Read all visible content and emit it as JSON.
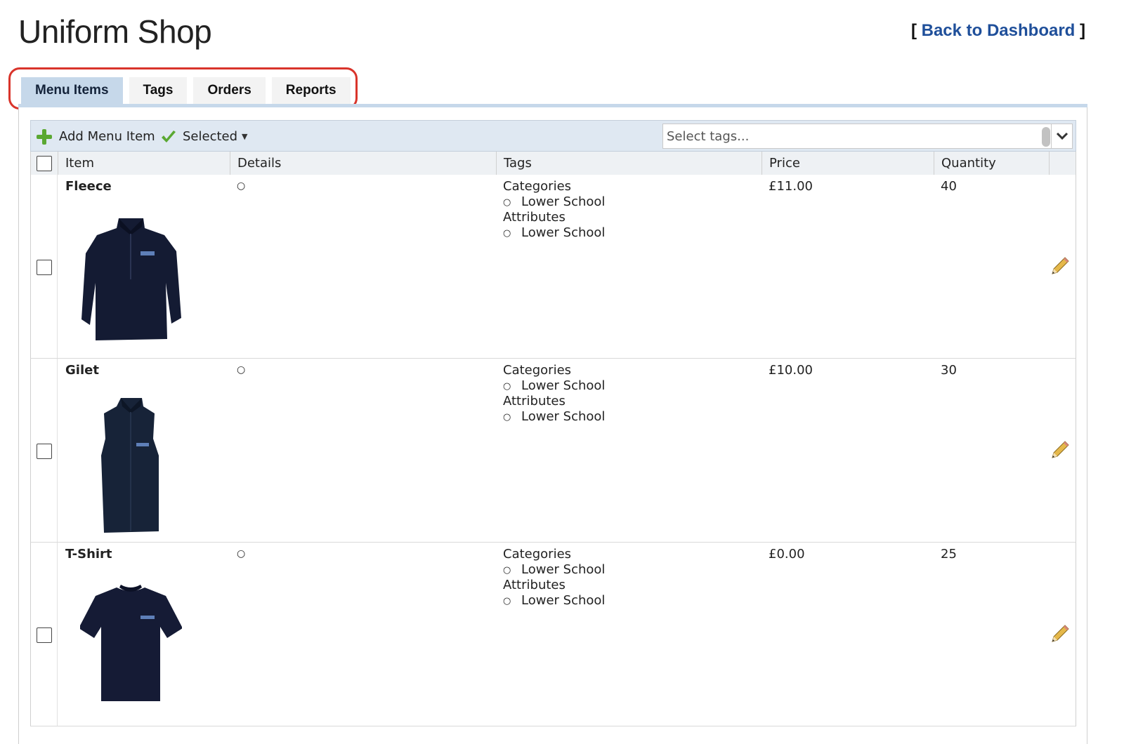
{
  "header": {
    "title": "Uniform Shop",
    "back_link": "Back to Dashboard",
    "back_open": "[",
    "back_close": "]"
  },
  "tabs": [
    {
      "label": "Menu Items",
      "active": true
    },
    {
      "label": "Tags",
      "active": false
    },
    {
      "label": "Orders",
      "active": false
    },
    {
      "label": "Reports",
      "active": false
    }
  ],
  "toolbar": {
    "add_label": "Add Menu Item",
    "selected_label": "Selected",
    "tag_placeholder": "Select tags..."
  },
  "columns": [
    "Item",
    "Details",
    "Tags",
    "Price",
    "Quantity"
  ],
  "items": [
    {
      "name": "Fleece",
      "details_bullet": "○",
      "categories_label": "Categories",
      "category": "Lower School",
      "attributes_label": "Attributes",
      "attribute": "Lower School",
      "price": "£11.00",
      "quantity": "40",
      "image": "fleece-jacket"
    },
    {
      "name": "Gilet",
      "details_bullet": "○",
      "categories_label": "Categories",
      "category": "Lower School",
      "attributes_label": "Attributes",
      "attribute": "Lower School",
      "price": "£10.00",
      "quantity": "30",
      "image": "gilet-vest"
    },
    {
      "name": "T-Shirt",
      "details_bullet": "○",
      "categories_label": "Categories",
      "category": "Lower School",
      "attributes_label": "Attributes",
      "attribute": "Lower School",
      "price": "£0.00",
      "quantity": "25",
      "image": "t-shirt"
    }
  ],
  "colors": {
    "accent": "#1f4f9a",
    "tab_active": "#c6d8ea",
    "highlight": "#d9342b",
    "add_icon": "#5aa832"
  }
}
